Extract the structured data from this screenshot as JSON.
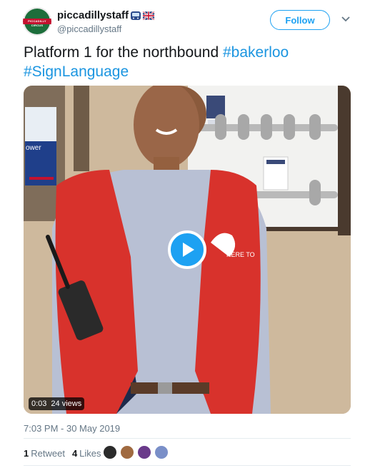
{
  "user": {
    "display_name": "piccadillystaff",
    "handle": "@piccadillystaff",
    "avatar_text": "PICCADILLY CIRCUS"
  },
  "follow_label": "Follow",
  "tweet": {
    "text_plain": "Platform 1 for the northbound ",
    "hashtag1": "#bakerloo",
    "hashtag2": "#SignLanguage"
  },
  "video": {
    "duration": "0:03",
    "views": "24 views",
    "sign_text": "ower",
    "badge_text": "HERE TO"
  },
  "timestamp": "7:03 PM - 30 May 2019",
  "stats": {
    "retweets_count": "1",
    "retweets_label": "Retweet",
    "likes_count": "4",
    "likes_label": "Likes"
  },
  "colors": {
    "accent": "#1da1f2",
    "hashtag": "#1b95e0",
    "muted": "#657786"
  }
}
